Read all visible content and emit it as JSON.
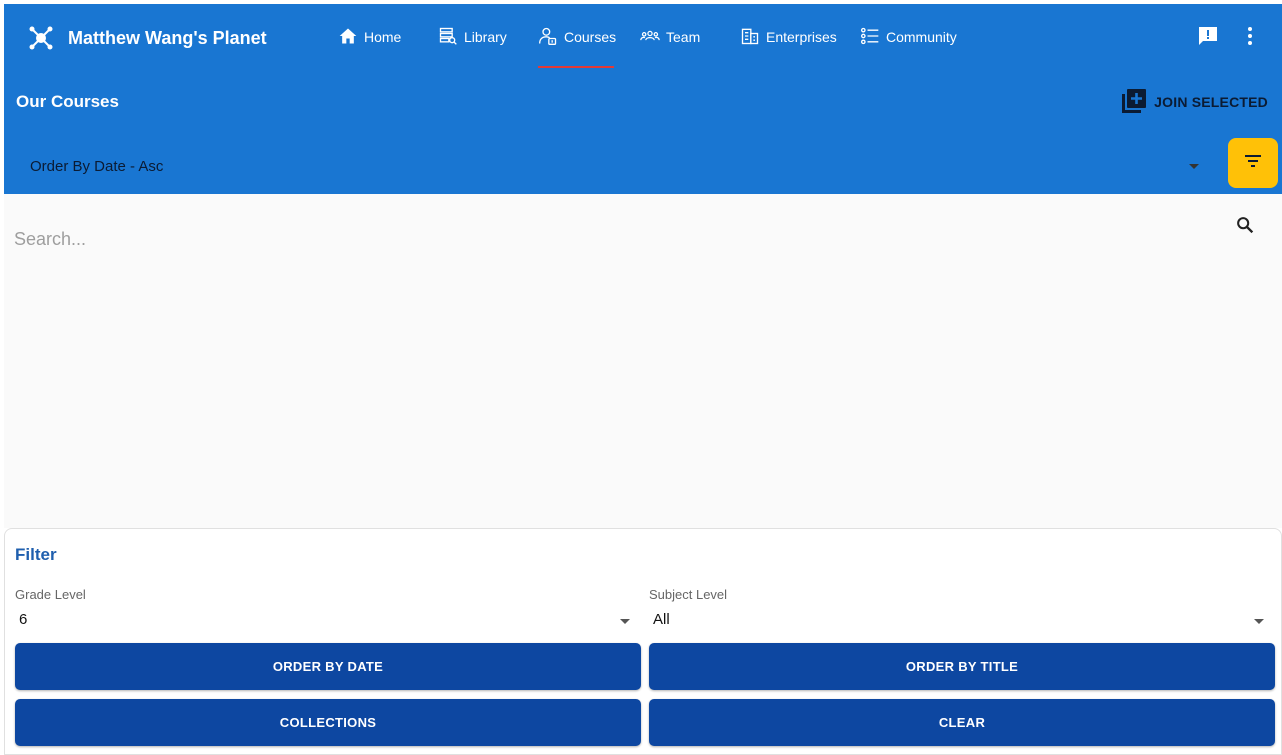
{
  "brand": {
    "name": "Matthew Wang's Planet",
    "logo_icon": "planet-logo-icon"
  },
  "nav": [
    {
      "label": "Home",
      "icon": "home-icon"
    },
    {
      "label": "Library",
      "icon": "library-icon"
    },
    {
      "label": "Courses",
      "icon": "courses-icon",
      "active": true
    },
    {
      "label": "Team",
      "icon": "team-icon"
    },
    {
      "label": "Enterprises",
      "icon": "enterprises-icon"
    },
    {
      "label": "Community",
      "icon": "community-icon"
    }
  ],
  "header": {
    "title": "Our Courses",
    "join_selected": "JOIN SELECTED",
    "sort_value": "Order By Date - Asc"
  },
  "search": {
    "placeholder": "Search..."
  },
  "filter": {
    "title": "Filter",
    "grade_label": "Grade Level",
    "grade_value": "6",
    "subject_label": "Subject Level",
    "subject_value": "All",
    "buttons": {
      "order_date": "ORDER BY DATE",
      "order_title": "ORDER BY TITLE",
      "collections": "COLLECTIONS",
      "clear": "CLEAR"
    }
  },
  "colors": {
    "primary": "#1976d2",
    "accent": "#ffc107",
    "button": "#0d47a1",
    "active_underline": "#e53935"
  }
}
